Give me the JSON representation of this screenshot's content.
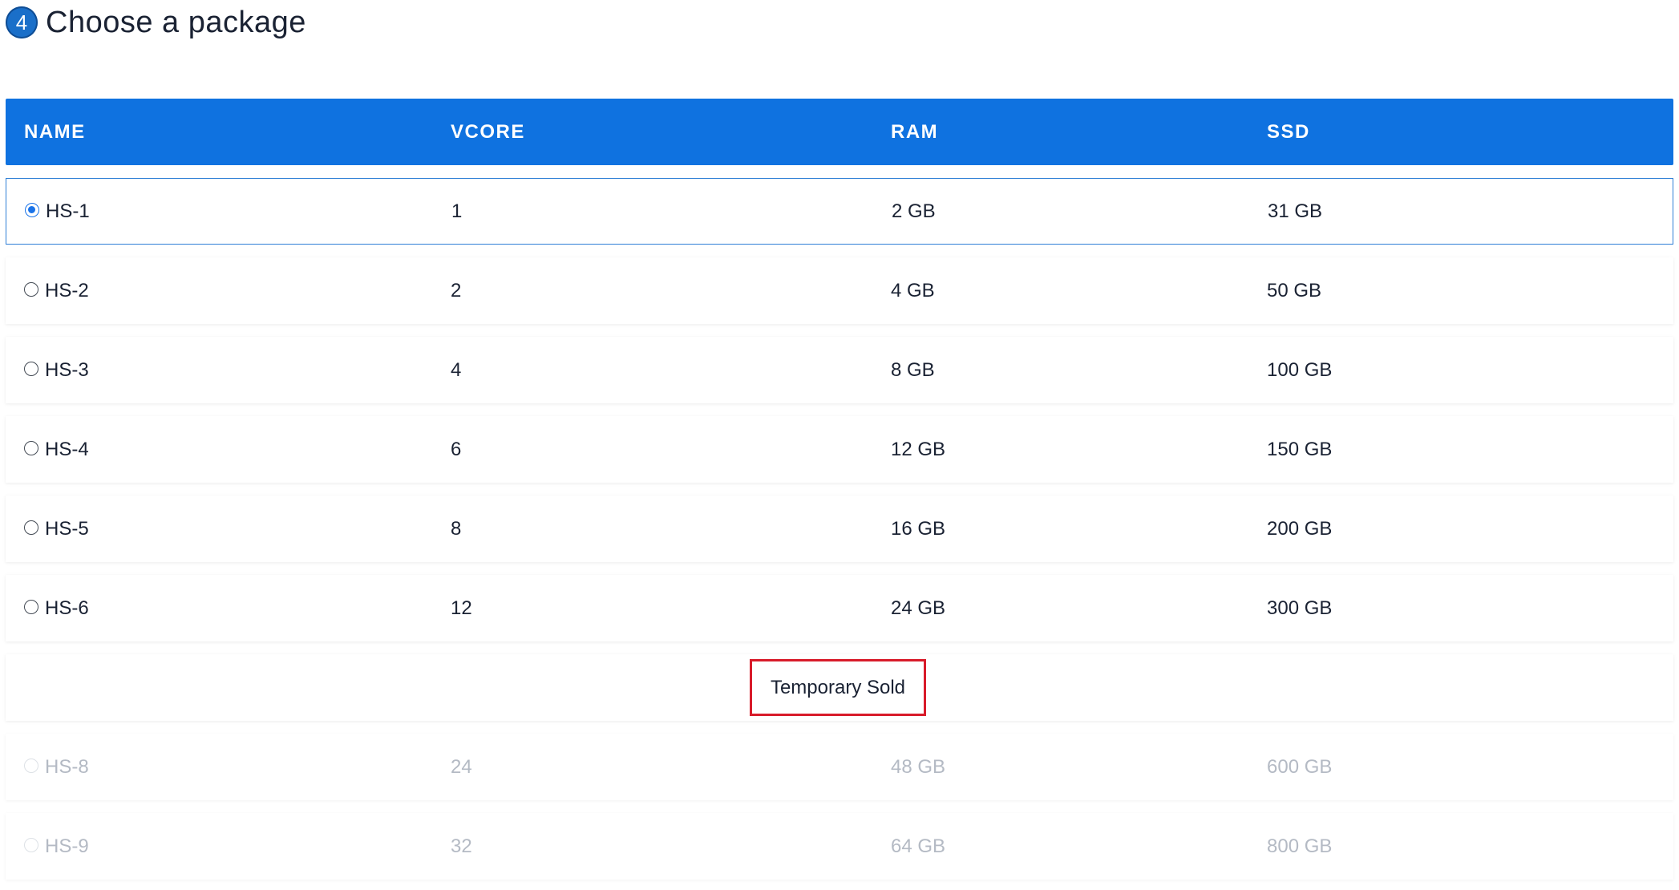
{
  "heading": {
    "step": "4",
    "title": "Choose a package"
  },
  "table": {
    "columns": [
      "NAME",
      "VCORE",
      "RAM",
      "SSD"
    ],
    "rows": [
      {
        "name": "HS-1",
        "vcore": "1",
        "ram": "2 GB",
        "ssd": "31 GB",
        "selected": true,
        "disabled": false
      },
      {
        "name": "HS-2",
        "vcore": "2",
        "ram": "4 GB",
        "ssd": "50 GB",
        "selected": false,
        "disabled": false
      },
      {
        "name": "HS-3",
        "vcore": "4",
        "ram": "8 GB",
        "ssd": "100 GB",
        "selected": false,
        "disabled": false
      },
      {
        "name": "HS-4",
        "vcore": "6",
        "ram": "12 GB",
        "ssd": "150 GB",
        "selected": false,
        "disabled": false
      },
      {
        "name": "HS-5",
        "vcore": "8",
        "ram": "16 GB",
        "ssd": "200 GB",
        "selected": false,
        "disabled": false
      },
      {
        "name": "HS-6",
        "vcore": "12",
        "ram": "24 GB",
        "ssd": "300 GB",
        "selected": false,
        "disabled": false
      }
    ],
    "sold_label": "Temporary Sold",
    "disabled_rows": [
      {
        "name": "HS-8",
        "vcore": "24",
        "ram": "48 GB",
        "ssd": "600 GB"
      },
      {
        "name": "HS-9",
        "vcore": "32",
        "ram": "64 GB",
        "ssd": "800 GB"
      }
    ]
  },
  "colors": {
    "header_bg": "#0f72e0",
    "selected_border": "#2f7fd6",
    "sold_border": "#d81b2a",
    "disabled_text": "#b4bac4"
  }
}
